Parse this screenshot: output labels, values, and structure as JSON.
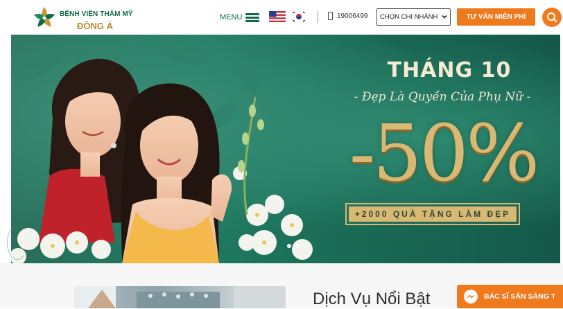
{
  "header": {
    "logo_line1": "BỆNH VIỆN THẨM MỸ",
    "logo_line2": "ĐÔNG Á",
    "menu_label": "MENU",
    "lang_en_icon": "flag-us-icon",
    "lang_kr_icon": "flag-korea-icon",
    "phone": "19006499",
    "branch_select": "CHỌN CHI NHÁNH",
    "consult_button": "TƯ VẤN MIỄN PHÍ",
    "search_icon": "search-icon"
  },
  "banner": {
    "month": "THÁNG 10",
    "slogan": "- Đẹp Là Quyền Của Phụ Nữ -",
    "discount": "-50%",
    "gift": "+2000 QUÀ TẶNG LÀM ĐẸP",
    "slides_total": 3,
    "active_slide": 1
  },
  "featured": {
    "title": "Dịch Vụ Nổi Bật"
  },
  "chat": {
    "label": "BÁC SĨ SẴN SÀNG T",
    "icon": "messenger-icon"
  },
  "colors": {
    "brand_green": "#0f6b47",
    "brand_gold": "#b88a2e",
    "accent_orange": "#ef7a1d",
    "banner_green": "#1e7a60"
  }
}
